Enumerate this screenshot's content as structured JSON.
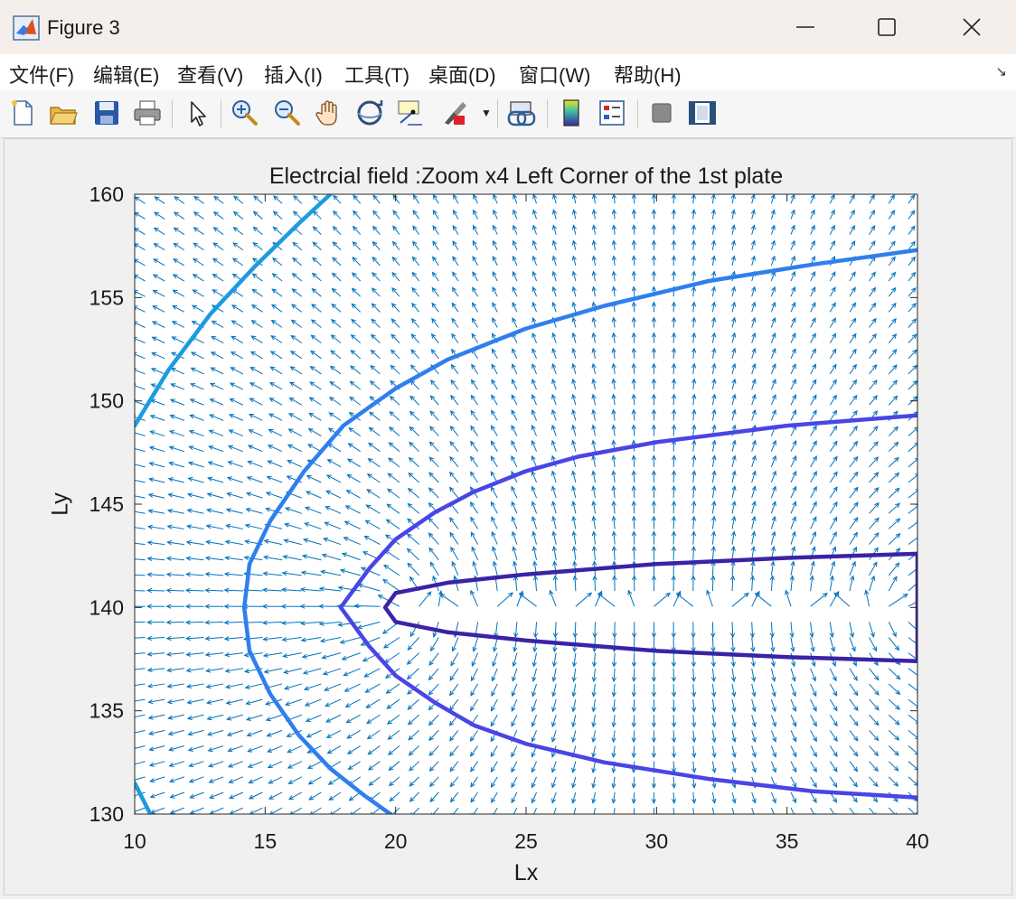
{
  "window": {
    "title": "Figure 3",
    "controls": [
      "minimize-icon",
      "maximize-icon",
      "close-icon"
    ]
  },
  "menu": {
    "items": [
      "文件(F)",
      "编辑(E)",
      "查看(V)",
      "插入(I)",
      "工具(T)",
      "桌面(D)",
      "窗口(W)",
      "帮助(H)"
    ],
    "corner_glyph": "↘"
  },
  "toolbar": {
    "icons": [
      "new-figure-icon",
      "open-file-icon",
      "save-icon",
      "print-icon",
      "pointer-icon",
      "zoom-in-icon",
      "zoom-out-icon",
      "pan-hand-icon",
      "rotate-3d-icon",
      "data-cursor-icon",
      "brush-icon",
      "link-plot-icon",
      "colorbar-icon",
      "legend-icon",
      "hide-plot-tools-icon",
      "show-plot-tools-icon"
    ]
  },
  "chart_data": {
    "type": "quiver-contour",
    "title": "Electrcial field :Zoom x4 Left Corner of the 1st plate",
    "xlabel": "Lx",
    "ylabel": "Ly",
    "xlim": [
      10,
      40
    ],
    "ylim": [
      130,
      160
    ],
    "xticks": [
      10,
      15,
      20,
      25,
      30,
      35,
      40
    ],
    "yticks": [
      130,
      135,
      140,
      145,
      150,
      155,
      160
    ],
    "grid": false,
    "plate": {
      "x_start": 20,
      "x_end": 40,
      "y": 140
    },
    "arrow_color": "#0072bd",
    "quiver_spacing": 0.75,
    "contours": [
      {
        "color": "#3a23a6",
        "points": [
          [
            19.6,
            140
          ],
          [
            20,
            140.7
          ],
          [
            22,
            141.2
          ],
          [
            25,
            141.6
          ],
          [
            30,
            142.1
          ],
          [
            35,
            142.4
          ],
          [
            40,
            142.6
          ],
          [
            40,
            137.4
          ],
          [
            35,
            137.6
          ],
          [
            30,
            137.9
          ],
          [
            25,
            138.4
          ],
          [
            22,
            138.8
          ],
          [
            20,
            139.3
          ],
          [
            19.6,
            140
          ]
        ]
      },
      {
        "color": "#4a45e6",
        "points": [
          [
            40,
            149.3
          ],
          [
            35,
            148.8
          ],
          [
            30,
            148
          ],
          [
            27,
            147.3
          ],
          [
            25,
            146.6
          ],
          [
            23,
            145.6
          ],
          [
            21.5,
            144.6
          ],
          [
            20,
            143.3
          ],
          [
            19,
            141.9
          ],
          [
            17.9,
            140
          ],
          [
            19,
            138.1
          ],
          [
            20,
            136.7
          ],
          [
            21.5,
            135.4
          ],
          [
            23,
            134.3
          ],
          [
            25,
            133.4
          ],
          [
            28,
            132.5
          ],
          [
            32,
            131.7
          ],
          [
            36,
            131.1
          ],
          [
            40,
            130.8
          ]
        ]
      },
      {
        "color": "#2f7fee",
        "points": [
          [
            40,
            157.3
          ],
          [
            36,
            156.6
          ],
          [
            32,
            155.8
          ],
          [
            28,
            154.6
          ],
          [
            25,
            153.5
          ],
          [
            22,
            152
          ],
          [
            20,
            150.6
          ],
          [
            18,
            148.8
          ],
          [
            16.5,
            146.6
          ],
          [
            15.2,
            144.2
          ],
          [
            14.4,
            142.1
          ],
          [
            14.2,
            140
          ],
          [
            14.4,
            137.9
          ],
          [
            15.2,
            135.8
          ],
          [
            16.3,
            133.8
          ],
          [
            17.5,
            132.2
          ],
          [
            18.8,
            130.9
          ],
          [
            19.8,
            130
          ]
        ]
      },
      {
        "color": "#1c9be0",
        "points": [
          [
            10,
            148.8
          ],
          [
            11.3,
            151.5
          ],
          [
            12.9,
            154.2
          ],
          [
            14.6,
            156.5
          ],
          [
            16.3,
            158.6
          ],
          [
            17.5,
            160
          ]
        ]
      },
      {
        "color": "#1c9be0",
        "points": [
          [
            10,
            131.5
          ],
          [
            10.6,
            130
          ]
        ]
      }
    ]
  }
}
